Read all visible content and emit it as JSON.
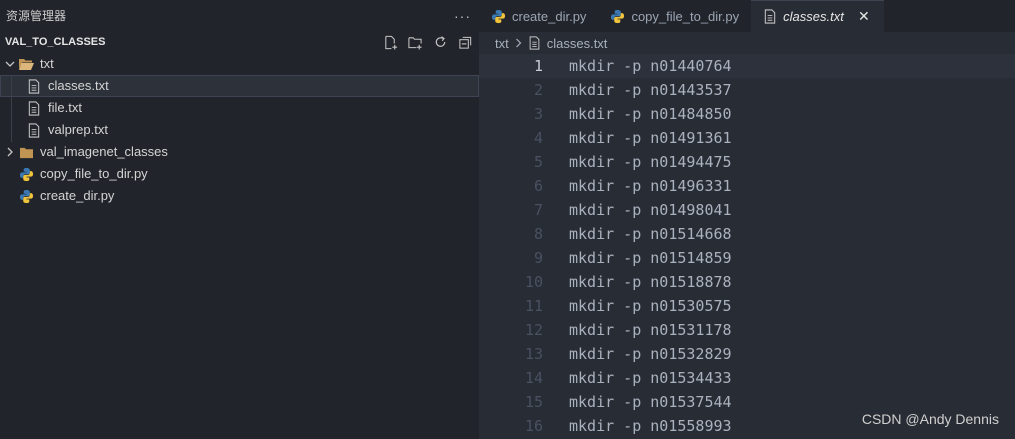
{
  "explorer": {
    "title": "资源管理器",
    "more": "···",
    "section": "VAL_TO_CLASSES",
    "actions": [
      "new-file-icon",
      "new-folder-icon",
      "refresh-icon",
      "collapse-all-icon"
    ],
    "tree": [
      {
        "label": "txt",
        "kind": "folder-open"
      },
      {
        "label": "classes.txt",
        "kind": "text-file",
        "selected": true
      },
      {
        "label": "file.txt",
        "kind": "text-file"
      },
      {
        "label": "valprep.txt",
        "kind": "text-file"
      },
      {
        "label": "val_imagenet_classes",
        "kind": "folder-closed"
      },
      {
        "label": "copy_file_to_dir.py",
        "kind": "python-file"
      },
      {
        "label": "create_dir.py",
        "kind": "python-file"
      }
    ]
  },
  "tabs": [
    {
      "label": "create_dir.py"
    },
    {
      "label": "copy_file_to_dir.py"
    },
    {
      "label": "classes.txt",
      "close": "✕"
    }
  ],
  "breadcrumb": {
    "folder": "txt",
    "file": "classes.txt"
  },
  "editor": {
    "lines": [
      {
        "n": "1",
        "text": "mkdir -p n01440764"
      },
      {
        "n": "2",
        "text": "mkdir -p n01443537"
      },
      {
        "n": "3",
        "text": "mkdir -p n01484850"
      },
      {
        "n": "4",
        "text": "mkdir -p n01491361"
      },
      {
        "n": "5",
        "text": "mkdir -p n01494475"
      },
      {
        "n": "6",
        "text": "mkdir -p n01496331"
      },
      {
        "n": "7",
        "text": "mkdir -p n01498041"
      },
      {
        "n": "8",
        "text": "mkdir -p n01514668"
      },
      {
        "n": "9",
        "text": "mkdir -p n01514859"
      },
      {
        "n": "10",
        "text": "mkdir -p n01518878"
      },
      {
        "n": "11",
        "text": "mkdir -p n01530575"
      },
      {
        "n": "12",
        "text": "mkdir -p n01531178"
      },
      {
        "n": "13",
        "text": "mkdir -p n01532829"
      },
      {
        "n": "14",
        "text": "mkdir -p n01534433"
      },
      {
        "n": "15",
        "text": "mkdir -p n01537544"
      },
      {
        "n": "16",
        "text": "mkdir -p n01558993"
      }
    ]
  },
  "watermark": "CSDN @Andy Dennis",
  "colors": {
    "sidebar_bg": "#21252b",
    "editor_bg": "#282c34",
    "folder": "#c09553",
    "python_blue": "#3b79b4",
    "python_yellow": "#f0c33c"
  }
}
